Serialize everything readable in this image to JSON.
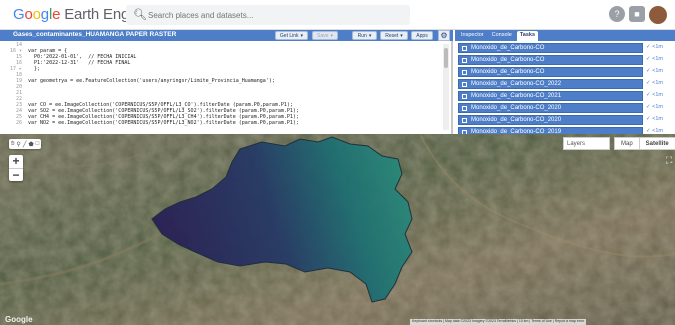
{
  "header": {
    "logo_google": "Google",
    "logo_rest": " Earth Engine",
    "search_placeholder": "Search places and datasets..."
  },
  "editor": {
    "script_title": "Gases_contaminantes_HUAMANGA PAPER RASTER",
    "buttons": {
      "get_link": "Get Link",
      "save": "Save",
      "run": "Run",
      "reset": "Reset",
      "apps": "Apps"
    },
    "lines": [
      {
        "n": "14",
        "text": ""
      },
      {
        "n": "16 ▾",
        "text": "var param = {"
      },
      {
        "n": "15",
        "text": "  P0:'2022-01-01',  // FECHA INICIAL"
      },
      {
        "n": "16",
        "text": "  P1:'2022-12-31'   // FECHA FINAL"
      },
      {
        "n": "17 ▸",
        "text": "  };"
      },
      {
        "n": "18",
        "text": ""
      },
      {
        "n": "19",
        "text": "var geometrya = ee.FeatureCollection('users/anyringsr/Limite_Provincia_Huamanga');"
      },
      {
        "n": "20",
        "text": ""
      },
      {
        "n": "21",
        "text": ""
      },
      {
        "n": "22",
        "text": ""
      },
      {
        "n": "23",
        "text": "var CO = ee.ImageCollection('COPERNICUS/S5P/OFFL/L3_CO').filterDate (param.P0,param.P1);"
      },
      {
        "n": "24",
        "text": "var SO2 = ee.ImageCollection('COPERNICUS/S5P/OFFL/L3_SO2').filterDate (param.P0,param.P1);"
      },
      {
        "n": "25",
        "text": "var CH4 = ee.ImageCollection('COPERNICUS/S5P/OFFL/L3_CH4').filterDate (param.P0,param.P1);"
      },
      {
        "n": "26",
        "text": "var NO2 = ee.ImageCollection('COPERNICUS/S5P/OFFL/L3_NO2').filterDate (param.P0,param.P1);"
      }
    ]
  },
  "rpanel": {
    "tabs": [
      "Inspector",
      "Console",
      "Tasks"
    ],
    "active_tab": "Tasks",
    "tasks": [
      {
        "name": "Monoxido_de_Carbono-CO",
        "status": "✓ <1m"
      },
      {
        "name": "Monoxido_de_Carbono-CO",
        "status": "✓ <1m"
      },
      {
        "name": "Monoxido_de_Carbono-CO",
        "status": "✓ <1m"
      },
      {
        "name": "Monoxido_de_Carbono-CO_2022",
        "status": "✓ <1m"
      },
      {
        "name": "Monoxido_de_Carbono-CO_2021",
        "status": "✓ <1m"
      },
      {
        "name": "Monoxido_de_Carbono-CO_2020",
        "status": "✓ <1m"
      },
      {
        "name": "Monoxido_de_Carbono-CO_2020",
        "status": "✓ <1m"
      },
      {
        "name": "Monoxido_de_Carbono-CO_2019",
        "status": "✓ <1m"
      }
    ]
  },
  "map": {
    "layers_label": "Layers",
    "map_type_options": [
      "Map",
      "Satellite"
    ],
    "map_type_selected": "Satellite",
    "zoom_in": "+",
    "zoom_out": "−",
    "google_watermark": "Google",
    "attribution": "Keyboard shortcuts | Map data ©2023 Imagery ©2023 TerraMetrics | 10 km | Terms of Use | Report a map error"
  },
  "colors": {
    "accent_blue": "#4e7ec8",
    "raster_teal": "#1f6f72",
    "raster_purple": "#2a1f55"
  }
}
